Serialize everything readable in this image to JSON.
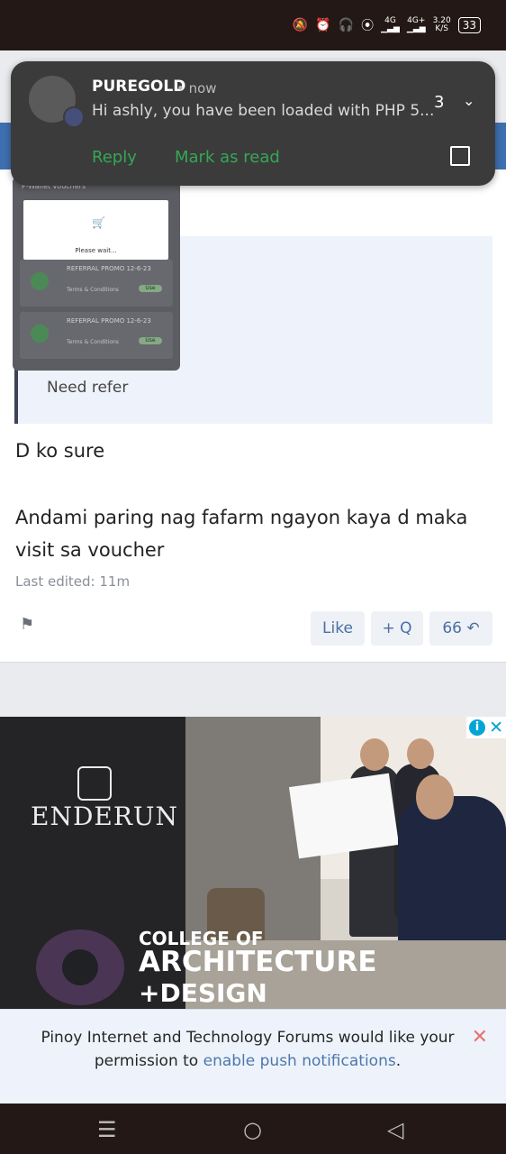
{
  "status": {
    "icons": [
      "mute-icon",
      "alarm-icon",
      "headset-icon",
      "hotspot-icon",
      "signal-4g-icon",
      "signal-4g-plus-icon"
    ],
    "network_4g": "4G",
    "network_4g_plus": "4G+",
    "speed_value": "3.20",
    "speed_unit": "K/S",
    "battery": "33"
  },
  "notification": {
    "app_name": "PUREGOLD",
    "time": "now",
    "message": "Hi ashly, you have been loaded with PHP 5...",
    "count": "3",
    "reply_label": "Reply",
    "mark_read_label": "Mark as read"
  },
  "thumbnail": {
    "title": "P-Wallet vouchers",
    "wait_text": "Please wait...",
    "items": [
      {
        "title": "REFERRAL PROMO 12-6-23",
        "terms": "Terms & Conditions",
        "button": "Use"
      },
      {
        "title": "REFERRAL PROMO 12-6-23",
        "terms": "Terms & Conditions",
        "button": "Use"
      }
    ]
  },
  "post": {
    "quote_text": "Need refer",
    "line1": "D ko sure",
    "line2": "Andami paring nag fafarm ngayon kaya d maka",
    "line3": "visit sa voucher",
    "edited": "Last edited: 11m",
    "like_label": "Like",
    "quote_label": "+ Q",
    "quote_marks": "66"
  },
  "ad": {
    "brand": "ENDERUN",
    "line1": "COLLEGE OF",
    "line2": "ARCHITECTURE",
    "line3": "+DESIGN",
    "adchoice_info": "i",
    "adchoice_close": "✕"
  },
  "push": {
    "text_before": "Pinoy Internet and Technology Forums would like your permission to",
    "link_text": "enable push notifications",
    "text_after": ".",
    "close": "✕"
  },
  "nav": {
    "menu": "☰",
    "home": "○",
    "back": "◁"
  }
}
